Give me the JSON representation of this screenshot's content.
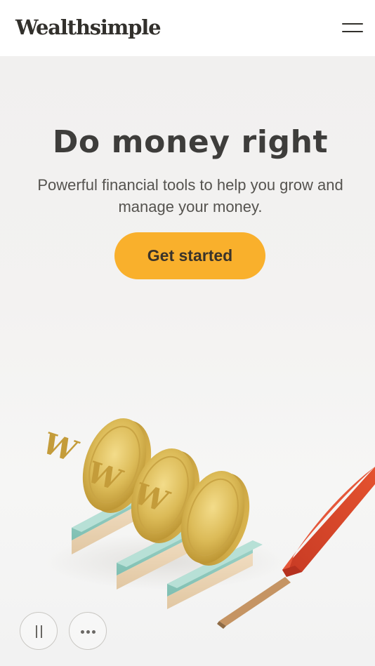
{
  "header": {
    "logo_text": "Wealthsimple",
    "menu_icon": "hamburger-menu-icon"
  },
  "hero": {
    "headline": "Do money right",
    "subheadline": "Powerful financial tools to help you grow and manage your money.",
    "cta_label": "Get started",
    "illustration": "three-gold-coins-with-w-logo-and-red-lever"
  },
  "media_controls": {
    "pause_icon": "pause-icon",
    "more_icon": "more-options-icon"
  },
  "colors": {
    "cta_background": "#f9b02c",
    "text_dark": "#3e3d3b",
    "hero_background": "#f3f2f1",
    "lever_red": "#d8432b",
    "coin_gold": "#d6b450"
  }
}
